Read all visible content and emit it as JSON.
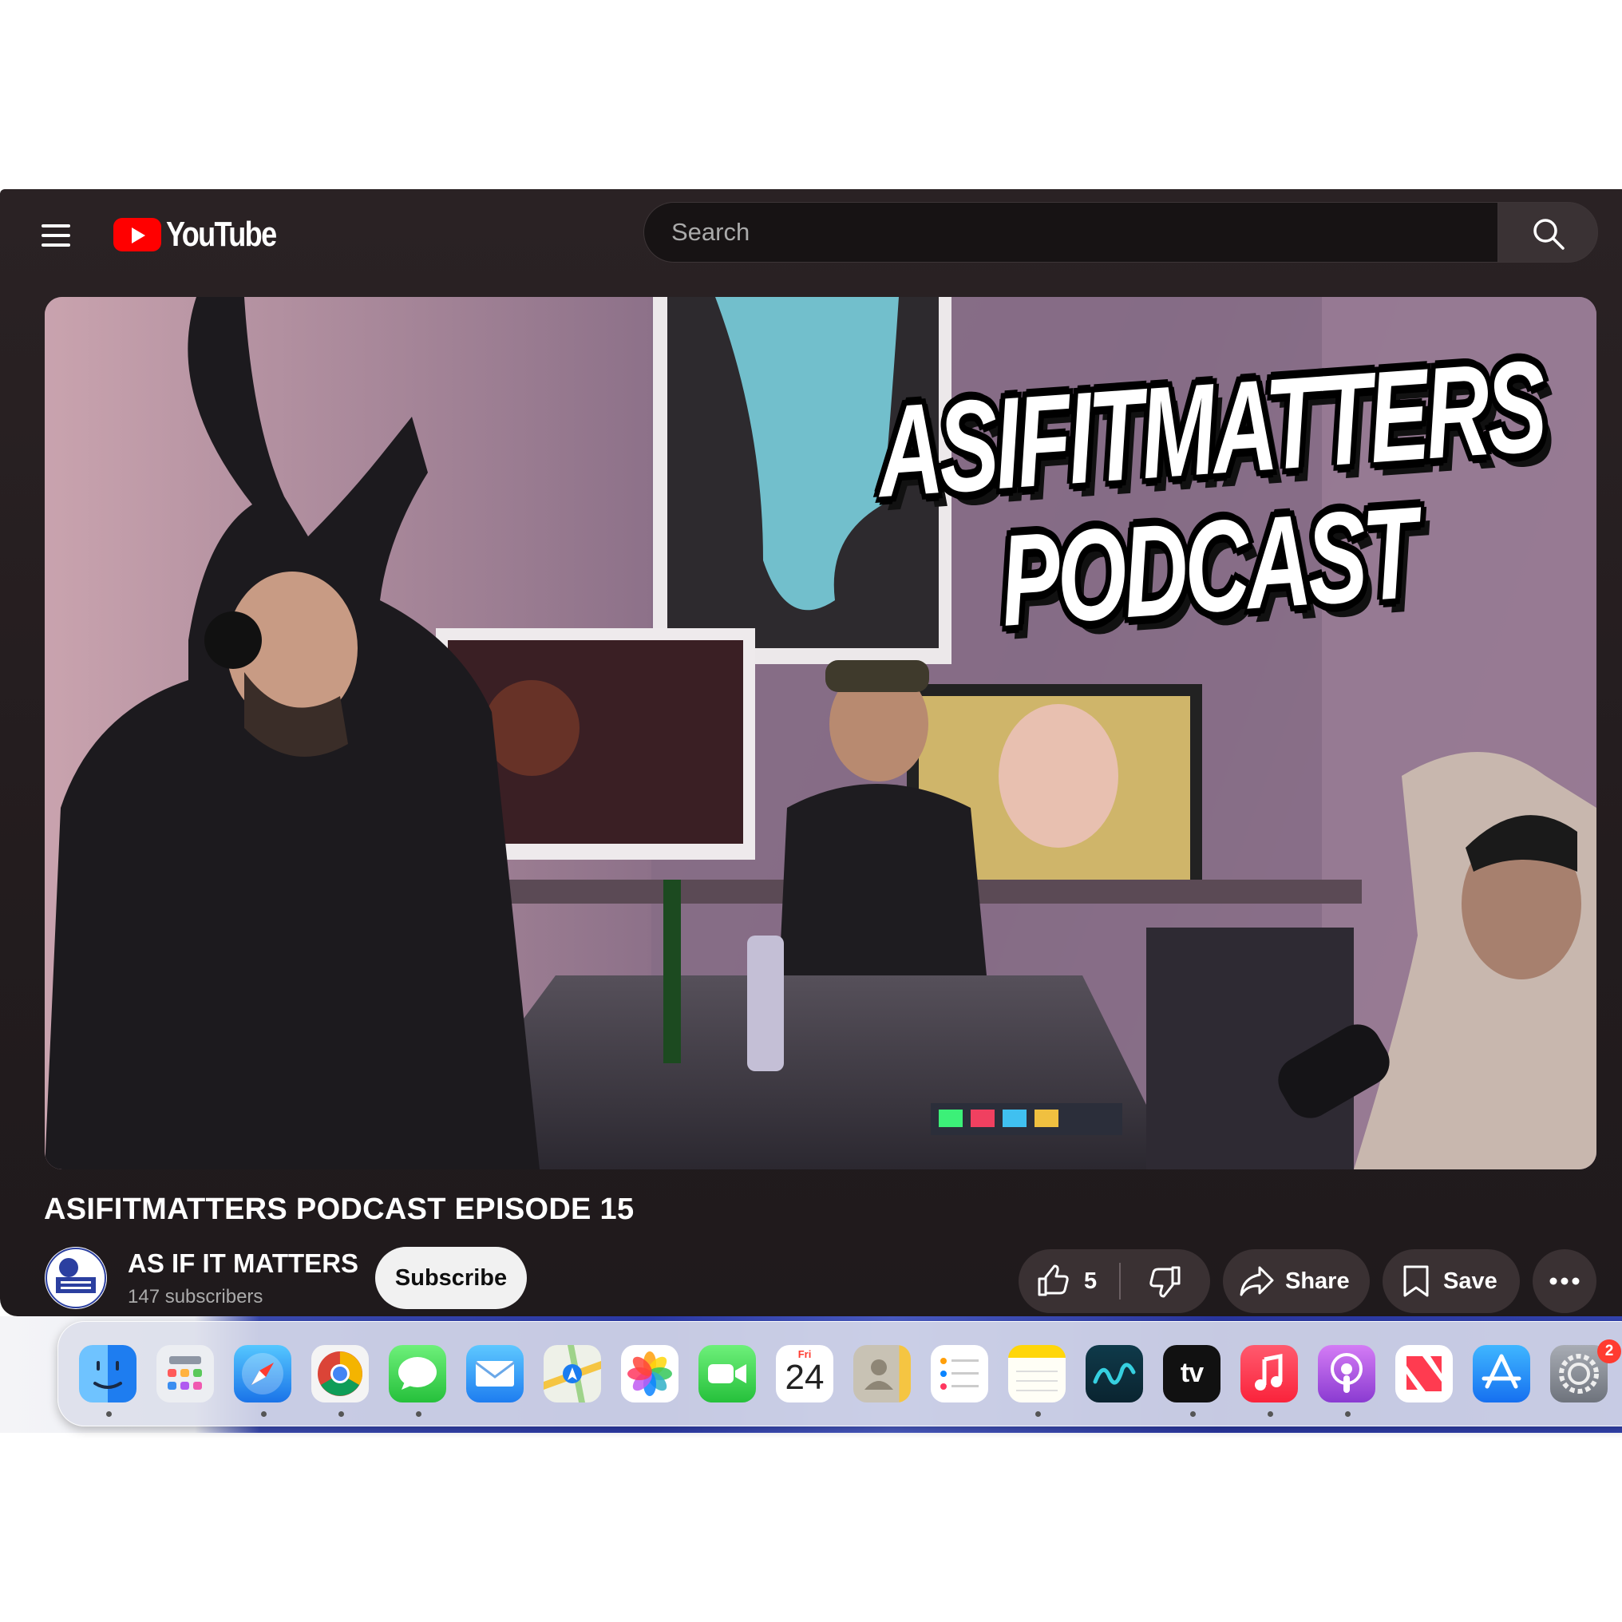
{
  "header": {
    "logo_text": "YouTube",
    "search_placeholder": "Search"
  },
  "thumbnail": {
    "title_line1": "ASIFITMATTERS",
    "title_line2": "PODCAST"
  },
  "video": {
    "title": "ASIFITMATTERS PODCAST EPISODE 15",
    "channel_name": "AS IF IT MATTERS",
    "subscribers": "147 subscribers",
    "subscribe_label": "Subscribe",
    "like_count": "5",
    "share_label": "Share",
    "save_label": "Save"
  },
  "dock": {
    "calendar_day": "Fri",
    "calendar_date": "24",
    "tv_label": "tv",
    "settings_badge": "2",
    "items": [
      "Finder",
      "Launchpad",
      "Safari",
      "Chrome",
      "Messages",
      "Mail",
      "Maps",
      "Photos",
      "FaceTime",
      "Calendar",
      "Contacts",
      "Reminders",
      "Notes",
      "Freeform",
      "TV",
      "Music",
      "Podcasts",
      "News",
      "App Store",
      "System Settings"
    ]
  },
  "colors": {
    "youtube_red": "#ff0000",
    "window_bg": "#231c1e",
    "pill_bg": "#3a3133",
    "subscribe_bg": "#f1f1f1"
  }
}
